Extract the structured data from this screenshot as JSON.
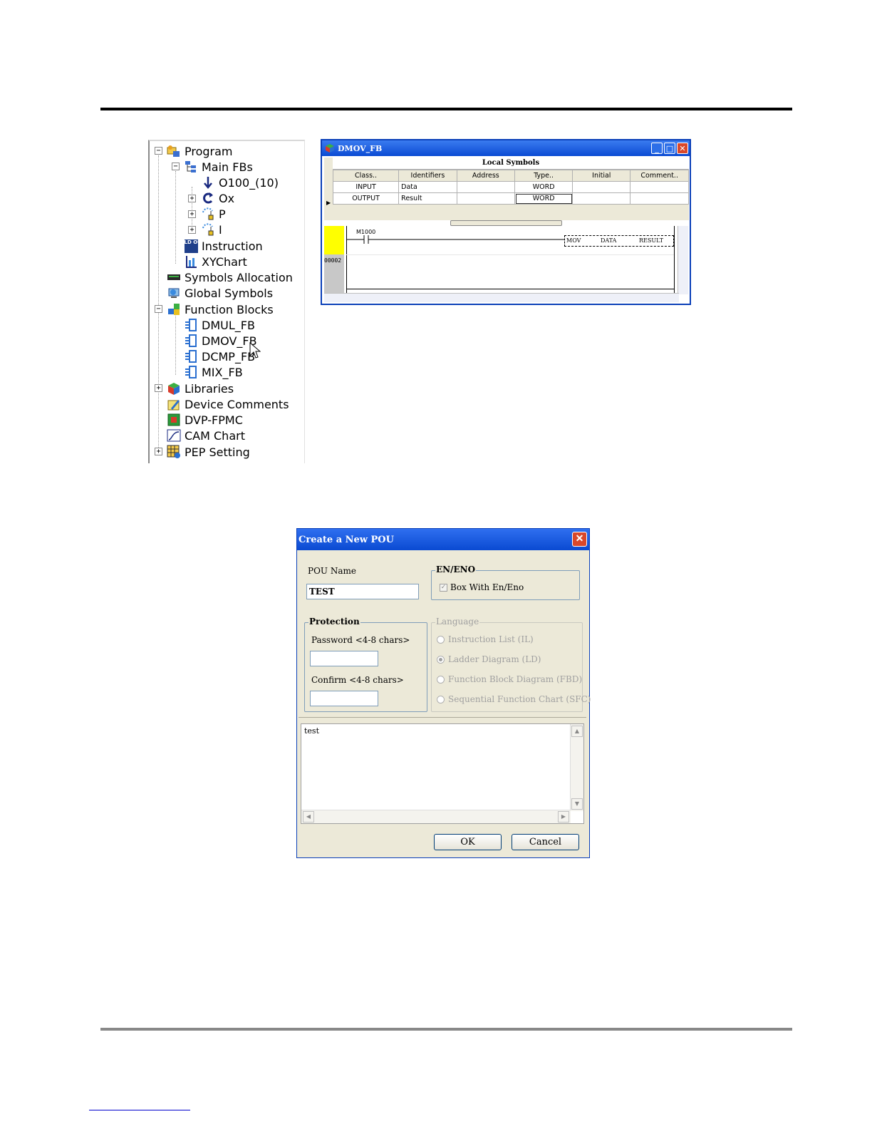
{
  "tree": {
    "items": [
      {
        "label": "Program",
        "icon": "program-folder-icon"
      },
      {
        "label": "Main FBs",
        "icon": "main-fbs-icon"
      },
      {
        "label": "O100_(10)",
        "icon": "down-arrow-icon"
      },
      {
        "label": "Ox",
        "icon": "cycle-icon"
      },
      {
        "label": "P",
        "icon": "p-task-icon"
      },
      {
        "label": "I",
        "icon": "i-task-icon"
      },
      {
        "label": "Instruction",
        "icon": "ld-out-icon",
        "icon_text": "LD OUT"
      },
      {
        "label": "XYChart",
        "icon": "xychart-icon"
      },
      {
        "label": "Symbols Allocation",
        "icon": "symbols-allocation-icon"
      },
      {
        "label": "Global Symbols",
        "icon": "global-symbols-icon"
      },
      {
        "label": "Function Blocks",
        "icon": "function-blocks-icon"
      },
      {
        "label": "DMUL_FB",
        "icon": "fb-icon"
      },
      {
        "label": "DMOV_FB",
        "icon": "fb-icon"
      },
      {
        "label": "DCMP_FB",
        "icon": "fb-icon"
      },
      {
        "label": "MIX_FB",
        "icon": "fb-icon"
      },
      {
        "label": "Libraries",
        "icon": "libraries-cube-icon"
      },
      {
        "label": "Device Comments",
        "icon": "device-comments-icon"
      },
      {
        "label": "DVP-FPMC",
        "icon": "dvp-fpmc-icon"
      },
      {
        "label": "CAM Chart",
        "icon": "cam-chart-icon"
      },
      {
        "label": "PEP Setting",
        "icon": "pep-setting-icon"
      }
    ]
  },
  "fb_window": {
    "title": "DMOV_FB",
    "local_symbols_header": "Local Symbols",
    "columns": [
      "Class..",
      "Identifiers",
      "Address",
      "Type..",
      "Initial",
      "Comment.."
    ],
    "rows": [
      [
        "INPUT",
        "Data",
        "",
        "WORD",
        "",
        ""
      ],
      [
        "OUTPUT",
        "Result",
        "",
        "WORD",
        "",
        ""
      ]
    ],
    "ladder": {
      "contact_label": "M1000",
      "instruction": "MOV",
      "operand1": "DATA",
      "operand2": "RESULT",
      "rung_number": "00002"
    }
  },
  "dialog": {
    "title": "Create a New POU",
    "pou_name_label": "POU Name",
    "pou_name_value": "TEST",
    "en_eno_label": "EN/ENO",
    "box_with_en_eno": "Box With En/Eno",
    "protection_label": "Protection",
    "password_label": "Password <4-8 chars>",
    "confirm_label": "Confirm <4-8 chars>",
    "language_label": "Language",
    "languages": [
      "Instruction List (IL)",
      "Ladder Diagram (LD)",
      "Function Block Diagram (FBD)",
      "Sequential Function Chart (SFC)"
    ],
    "selected_language": "Ladder Diagram (LD)",
    "comment_text": "test",
    "ok_label": "OK",
    "cancel_label": "Cancel"
  },
  "colors": {
    "title_bar": "#0b4bd3",
    "dialog_bg": "#ece9d8",
    "close_button": "#d9482b"
  }
}
